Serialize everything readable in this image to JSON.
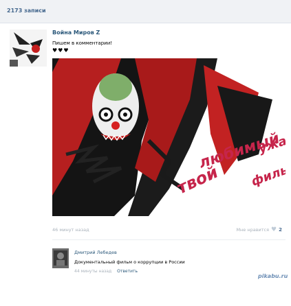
{
  "header": {
    "posts_count": "2173 записи"
  },
  "post": {
    "author": "Война Миров Z",
    "text": "Пишем в комментарии!",
    "emoji": "♥♥♥",
    "image_text": "твой любимый ужастик фильм",
    "time": "46 минут назад",
    "like_label": "Мне нравится",
    "likes": "2"
  },
  "comment": {
    "author": "Дмитрий Лебедев",
    "text": "Документальный фильм о коррупции в России",
    "time": "44 минуты назад",
    "reply": "Ответить"
  },
  "watermark": "pikabu.ru",
  "colors": {
    "link": "#2b587a",
    "accent": "#45688e",
    "muted": "#a9b2bb"
  }
}
